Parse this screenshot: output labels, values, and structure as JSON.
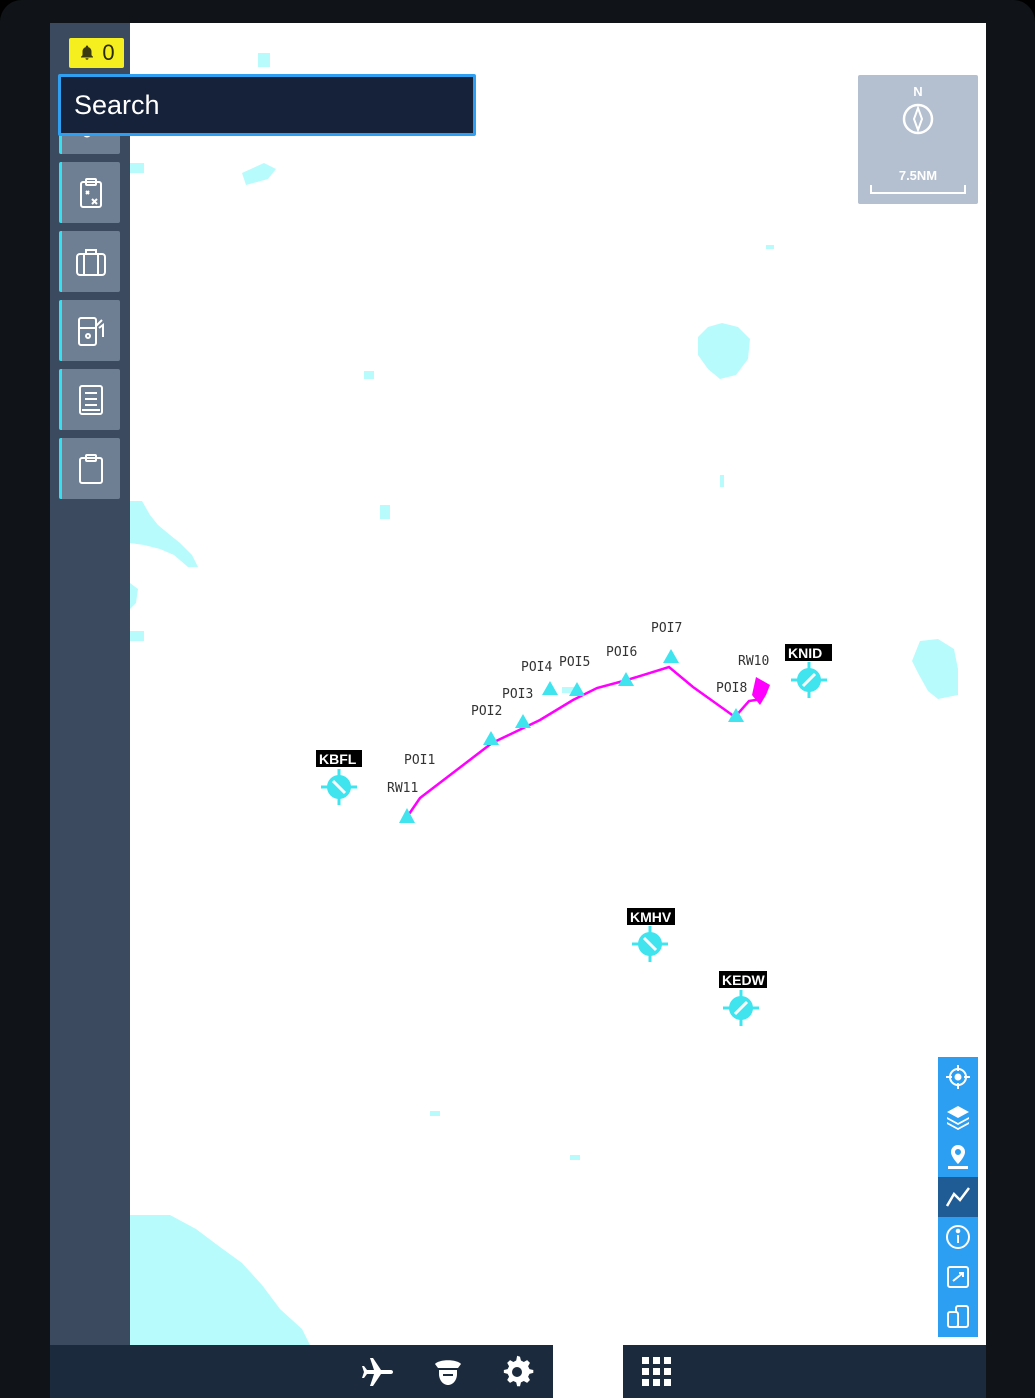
{
  "alerts": {
    "count": "0",
    "icon": "bell-icon"
  },
  "sidebar": {
    "items": [
      {
        "name": "sliders",
        "icon": "sliders-icon"
      },
      {
        "name": "checklist",
        "icon": "clipboard-x-icon"
      },
      {
        "name": "luggage",
        "icon": "briefcase-icon"
      },
      {
        "name": "fuel",
        "icon": "fuel-pump-icon"
      },
      {
        "name": "document",
        "icon": "document-icon"
      },
      {
        "name": "clipboard",
        "icon": "clipboard-icon"
      }
    ]
  },
  "search": {
    "placeholder": "Search"
  },
  "compass": {
    "north": "N",
    "scale": "7.5NM"
  },
  "route": {
    "waypoints": [
      {
        "id": "RW11",
        "label": "RW11"
      },
      {
        "id": "POI1",
        "label": "POI1"
      },
      {
        "id": "POI2",
        "label": "POI2"
      },
      {
        "id": "POI3",
        "label": "POI3"
      },
      {
        "id": "POI4",
        "label": "POI4"
      },
      {
        "id": "POI5",
        "label": "POI5"
      },
      {
        "id": "POI6",
        "label": "POI6"
      },
      {
        "id": "POI7",
        "label": "POI7"
      },
      {
        "id": "POI8",
        "label": "POI8"
      },
      {
        "id": "RW10",
        "label": "RW10"
      }
    ],
    "color": "#ff00ff"
  },
  "airports": [
    {
      "code": "KBFL"
    },
    {
      "code": "KNID"
    },
    {
      "code": "KMHV"
    },
    {
      "code": "KEDW"
    }
  ],
  "map_tools": [
    {
      "name": "center",
      "icon": "crosshair-icon"
    },
    {
      "name": "layers",
      "icon": "layers-icon"
    },
    {
      "name": "pin",
      "icon": "location-pin-icon"
    },
    {
      "name": "route",
      "icon": "route-icon",
      "active": true
    },
    {
      "name": "info",
      "icon": "info-icon"
    },
    {
      "name": "fullscreen",
      "icon": "expand-icon"
    },
    {
      "name": "pages",
      "icon": "pages-icon"
    }
  ],
  "bottom_bar": [
    {
      "name": "aircraft",
      "icon": "airplane-icon"
    },
    {
      "name": "pilot",
      "icon": "pilot-icon"
    },
    {
      "name": "settings",
      "icon": "gear-icon"
    },
    {
      "name": "apps",
      "icon": "grid-icon"
    }
  ],
  "colors": {
    "accent": "#36e0f0",
    "water": "#b8fbfc",
    "waypoint": "#3fe4ef",
    "sidebar": "#3b4a5e",
    "search_border": "#2f9ff2"
  }
}
